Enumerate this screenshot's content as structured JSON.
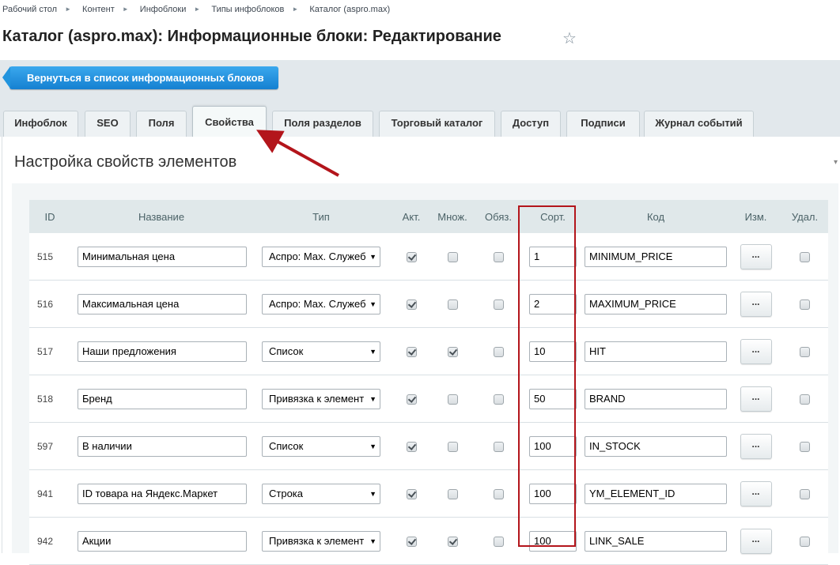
{
  "breadcrumb": [
    "Рабочий стол",
    "Контент",
    "Инфоблоки",
    "Типы инфоблоков",
    "Каталог (aspro.max)"
  ],
  "page_title": "Каталог (aspro.max): Информационные блоки: Редактирование",
  "back_button": "Вернуться в список информационных блоков",
  "tabs": [
    "Инфоблок",
    "SEO",
    "Поля",
    "Свойства",
    "Поля разделов",
    "Торговый каталог",
    "Доступ",
    "Подписи",
    "Журнал событий"
  ],
  "active_tab": "Свойства",
  "section_title": "Настройка свойств элементов",
  "columns": {
    "id": "ID",
    "name": "Название",
    "type": "Тип",
    "active": "Акт.",
    "multiple": "Множ.",
    "required": "Обяз.",
    "sort": "Сорт.",
    "code": "Код",
    "edit": "Изм.",
    "delete": "Удал."
  },
  "edit_label": "...",
  "rows": [
    {
      "id": "515",
      "name": "Минимальная цена",
      "type": "Аспро: Max. Служеб",
      "active": true,
      "multiple": false,
      "required": false,
      "sort": "1",
      "code": "MINIMUM_PRICE"
    },
    {
      "id": "516",
      "name": "Максимальная цена",
      "type": "Аспро: Max. Служеб",
      "active": true,
      "multiple": false,
      "required": false,
      "sort": "2",
      "code": "MAXIMUM_PRICE"
    },
    {
      "id": "517",
      "name": "Наши предложения",
      "type": "Список",
      "active": true,
      "multiple": true,
      "required": false,
      "sort": "10",
      "code": "HIT"
    },
    {
      "id": "518",
      "name": "Бренд",
      "type": "Привязка к элемент",
      "active": true,
      "multiple": false,
      "required": false,
      "sort": "50",
      "code": "BRAND"
    },
    {
      "id": "597",
      "name": "В наличии",
      "type": "Список",
      "active": true,
      "multiple": false,
      "required": false,
      "sort": "100",
      "code": "IN_STOCK"
    },
    {
      "id": "941",
      "name": "ID товара на Яндекс.Маркет",
      "type": "Строка",
      "active": true,
      "multiple": false,
      "required": false,
      "sort": "100",
      "code": "YM_ELEMENT_ID"
    },
    {
      "id": "942",
      "name": "Акции",
      "type": "Привязка к элемент",
      "active": true,
      "multiple": true,
      "required": false,
      "sort": "100",
      "code": "LINK_SALE"
    }
  ],
  "colors": {
    "back_button": "#1e8fe0",
    "highlight": "#b3151b",
    "toolbar": "#e2e8ec"
  }
}
